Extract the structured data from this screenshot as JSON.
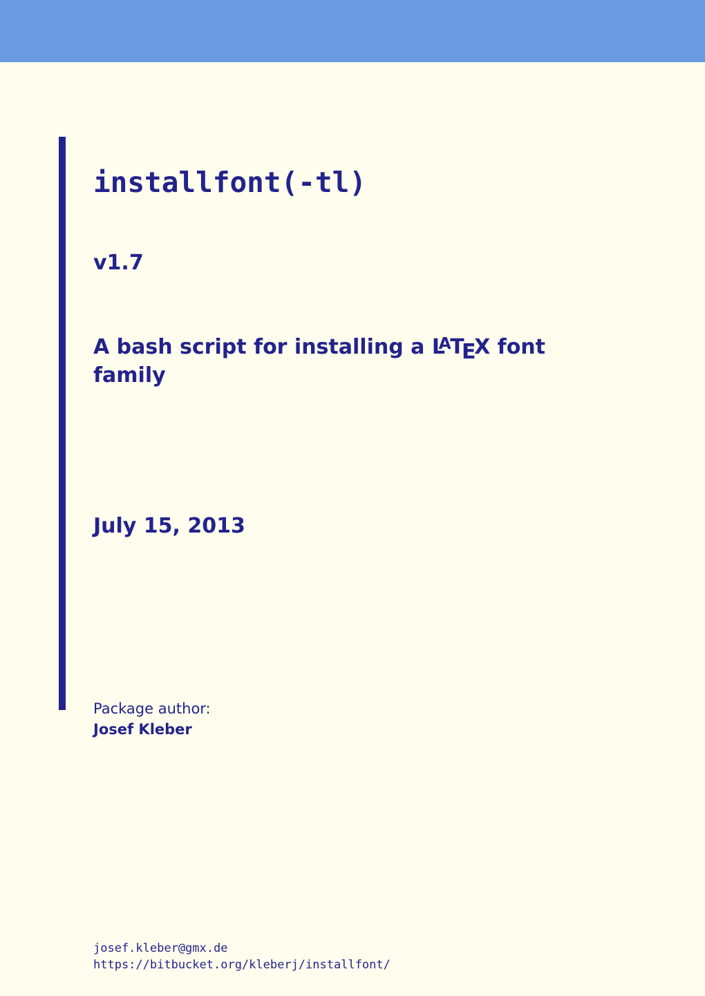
{
  "colors": {
    "banner": "#6a9ae0",
    "background": "#fffded",
    "accent": "#23238c"
  },
  "title": "installfont(-tl)",
  "version": "v1.7",
  "subtitle_pre": "A bash script for installing a ",
  "latex_L": "L",
  "latex_A": "A",
  "latex_T": "T",
  "latex_E": "E",
  "latex_X": "X",
  "subtitle_post": " font family",
  "date": "July 15, 2013",
  "author": {
    "label": "Package author:",
    "name": "Josef Kleber"
  },
  "footer": {
    "email": "josef.kleber@gmx.de",
    "url": "https://bitbucket.org/kleberj/installfont/"
  }
}
